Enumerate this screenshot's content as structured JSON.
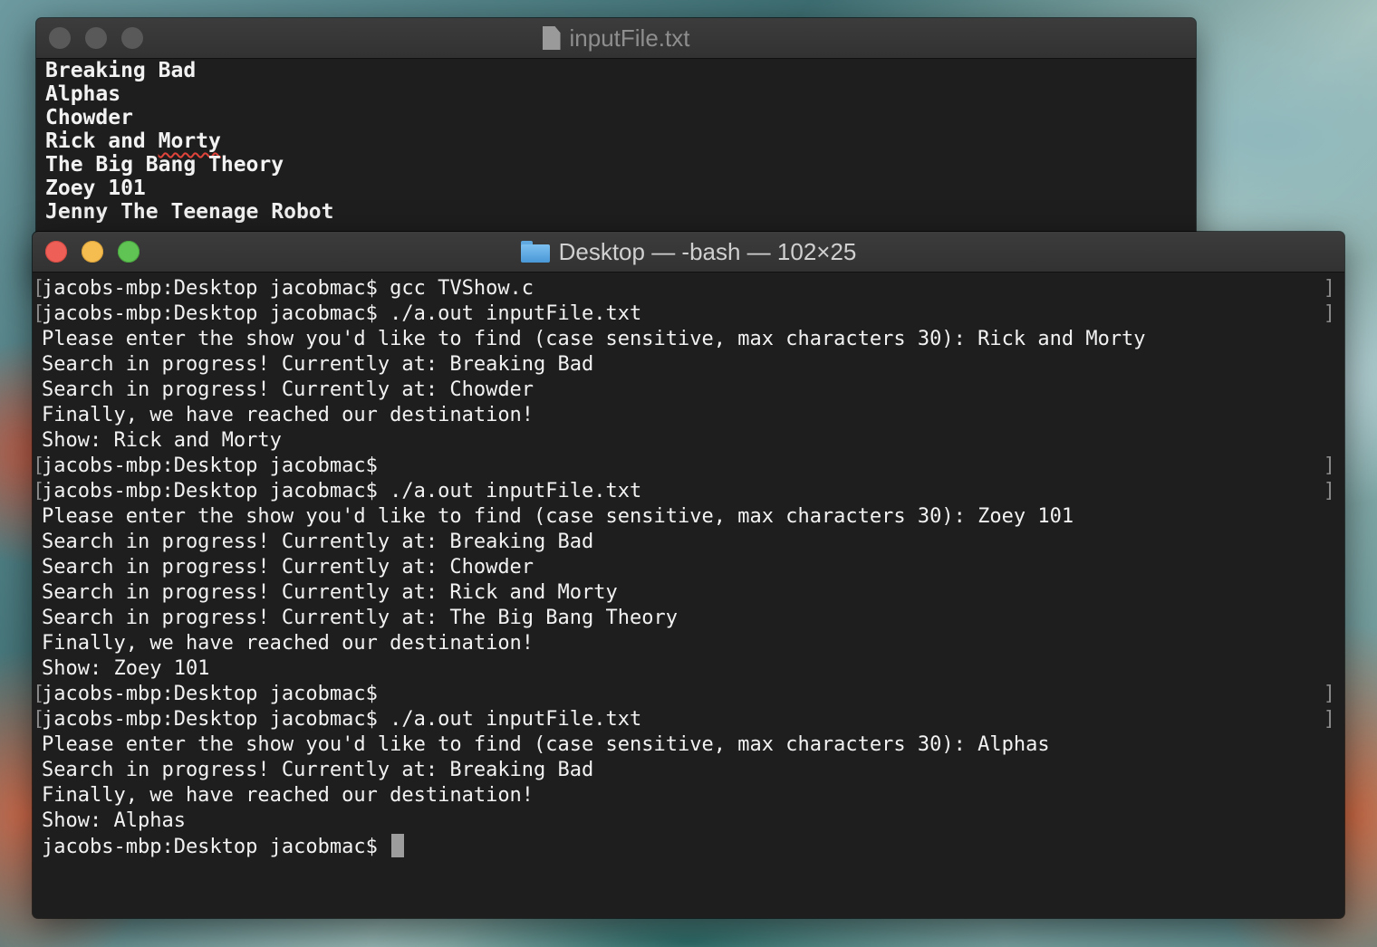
{
  "editor": {
    "title": "inputFile.txt",
    "icon": "document-icon",
    "lines": [
      "Breaking Bad",
      "Alphas",
      "Chowder",
      "Rick and Morty",
      "The Big Bang Theory",
      "Zoey 101",
      "Jenny The Teenage Robot"
    ],
    "spellcheck_word": "Morty"
  },
  "terminal": {
    "title": "Desktop — -bash — 102×25",
    "icon": "folder-icon",
    "lines": [
      {
        "text": "jacobs-mbp:Desktop jacobmac$ gcc TVShow.c",
        "prompt": true
      },
      {
        "text": "jacobs-mbp:Desktop jacobmac$ ./a.out inputFile.txt",
        "prompt": true
      },
      {
        "text": "Please enter the show you'd like to find (case sensitive, max characters 30): Rick and Morty",
        "prompt": false
      },
      {
        "text": "Search in progress! Currently at: Breaking Bad",
        "prompt": false
      },
      {
        "text": "Search in progress! Currently at: Chowder",
        "prompt": false
      },
      {
        "text": "Finally, we have reached our destination!",
        "prompt": false
      },
      {
        "text": "Show: Rick and Morty",
        "prompt": false
      },
      {
        "text": "jacobs-mbp:Desktop jacobmac$",
        "prompt": true
      },
      {
        "text": "jacobs-mbp:Desktop jacobmac$ ./a.out inputFile.txt",
        "prompt": true
      },
      {
        "text": "Please enter the show you'd like to find (case sensitive, max characters 30): Zoey 101",
        "prompt": false
      },
      {
        "text": "Search in progress! Currently at: Breaking Bad",
        "prompt": false
      },
      {
        "text": "Search in progress! Currently at: Chowder",
        "prompt": false
      },
      {
        "text": "Search in progress! Currently at: Rick and Morty",
        "prompt": false
      },
      {
        "text": "Search in progress! Currently at: The Big Bang Theory",
        "prompt": false
      },
      {
        "text": "Finally, we have reached our destination!",
        "prompt": false
      },
      {
        "text": "Show: Zoey 101",
        "prompt": false
      },
      {
        "text": "jacobs-mbp:Desktop jacobmac$",
        "prompt": true
      },
      {
        "text": "jacobs-mbp:Desktop jacobmac$ ./a.out inputFile.txt",
        "prompt": true
      },
      {
        "text": "Please enter the show you'd like to find (case sensitive, max characters 30): Alphas",
        "prompt": false
      },
      {
        "text": "Search in progress! Currently at: Breaking Bad",
        "prompt": false
      },
      {
        "text": "Finally, we have reached our destination!",
        "prompt": false
      },
      {
        "text": "Show: Alphas",
        "prompt": false
      }
    ],
    "current_prompt": "jacobs-mbp:Desktop jacobmac$ "
  },
  "colors": {
    "close": "#ed5f57",
    "minimize": "#f5bd4f",
    "zoom": "#5fc454",
    "inactive_light": "#595959",
    "inactive_title": "#8e8e8e",
    "active_title": "#d0d0d0"
  }
}
